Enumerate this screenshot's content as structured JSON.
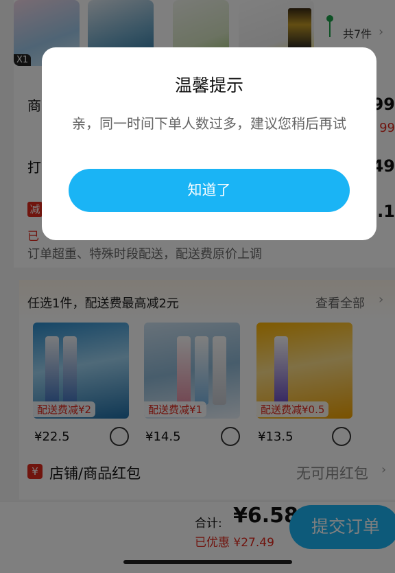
{
  "top_strip": {
    "corner_tag": "X1",
    "count_text": "共7件"
  },
  "order": {
    "goods_label": "商",
    "goods_price": "99",
    "goods_price_red": "99",
    "pack_label": "打",
    "pack_price": "49",
    "reduce_badge": "减",
    "reduce_value": ".1",
    "applied_text": "已",
    "notice": "订单超重、特殊时段配送，配送费原价上调"
  },
  "addon": {
    "title": "任选1件，配送费最高减2元",
    "more": "查看全部",
    "items": [
      {
        "ship_tag": "配送费减¥2",
        "price": "¥22.5"
      },
      {
        "ship_tag": "配送费减¥1",
        "price": "¥14.5"
      },
      {
        "ship_tag": "配送费减¥0.5",
        "price": "¥13.5"
      }
    ]
  },
  "red_packet": {
    "icon": "¥",
    "label": "店铺/商品红包",
    "value": "无可用红包"
  },
  "footer": {
    "total_label": "合计:",
    "total_value": "¥6.58",
    "saved": "已优惠 ¥27.49",
    "submit": "提交订单"
  },
  "dialog": {
    "title": "温馨提示",
    "message": "亲，同一时间下单人数过多，建议您稍后再试",
    "button": "知道了"
  },
  "colors": {
    "accent": "#1ab4f5",
    "price_red": "#e0281c"
  },
  "icons": [
    "chevron-right-icon",
    "yuan-icon"
  ]
}
